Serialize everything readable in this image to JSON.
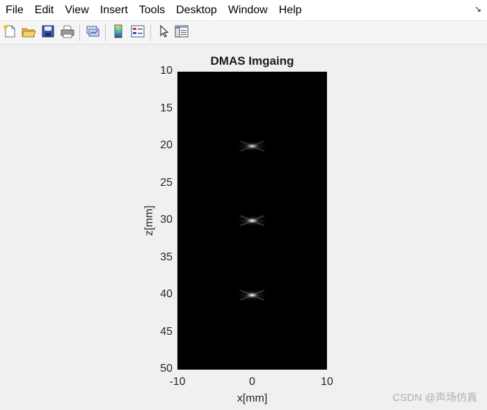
{
  "menu": [
    "File",
    "Edit",
    "View",
    "Insert",
    "Tools",
    "Desktop",
    "Window",
    "Help"
  ],
  "dock_icon": "dock-arrow-icon",
  "toolbar_icons": [
    "new-figure-icon",
    "open-file-icon",
    "save-icon",
    "print-icon",
    "link-plot-icon",
    "colorbar-icon",
    "legend-icon",
    "pointer-icon",
    "property-inspector-icon"
  ],
  "figure": {
    "title": "DMAS Imgaing",
    "xlabel": "x[mm]",
    "ylabel": "z[mm]",
    "xlim": [
      -10,
      10
    ],
    "ylim": [
      10,
      50
    ],
    "xticks": [
      "-10",
      "0",
      "10"
    ],
    "yticks": [
      "10",
      "15",
      "20",
      "25",
      "30",
      "35",
      "40",
      "45",
      "50"
    ],
    "background_color": "#000000"
  },
  "chart_data": {
    "type": "heatmap",
    "title": "DMAS Imgaing",
    "xlabel": "x[mm]",
    "ylabel": "z[mm]",
    "xlim": [
      -10,
      10
    ],
    "ylim": [
      10,
      50
    ],
    "y_direction": "reverse",
    "colormap": "gray",
    "point_targets": [
      {
        "x": 0,
        "z": 20,
        "intensity": 0.85
      },
      {
        "x": 0,
        "z": 30,
        "intensity": 1.0
      },
      {
        "x": 0,
        "z": 40,
        "intensity": 1.0
      }
    ]
  },
  "watermark": "CSDN @声场仿真"
}
